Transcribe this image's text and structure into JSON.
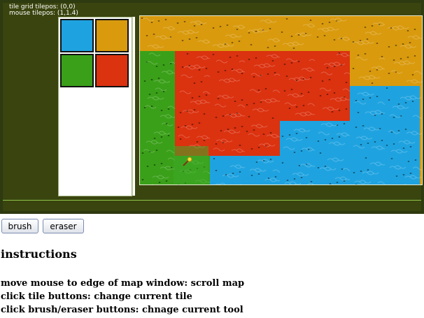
{
  "debug": {
    "tile_grid_pos": "tile grid tilepos: (0,0)",
    "mouse_pos": "mouse tilepos: (1,1.4)"
  },
  "palette": {
    "tiles": [
      {
        "name": "blue",
        "color": "#1fa3e0"
      },
      {
        "name": "orange",
        "color": "#d99a0e"
      },
      {
        "name": "green",
        "color": "#3aa019"
      },
      {
        "name": "red",
        "color": "#db3210"
      }
    ]
  },
  "map": {
    "tile_colors": {
      "B": "#1fa3e0",
      "O": "#d99a0e",
      "G": "#3aa019",
      "R": "#db3210"
    },
    "rows": [
      "OOOOOOOO",
      "GRRRRROO",
      "GRRRRRBB",
      "GRRRBBBB",
      "GGBBBBBB"
    ],
    "cursor_tile": {
      "col": 1,
      "row": 4
    }
  },
  "toolbar": {
    "brush_label": "brush",
    "eraser_label": "eraser"
  },
  "instructions": {
    "title": "instructions",
    "lines": [
      "move mouse to edge of map window: scroll map",
      "click tile buttons: change current tile",
      "click brush/eraser buttons: chnage current tool"
    ]
  }
}
